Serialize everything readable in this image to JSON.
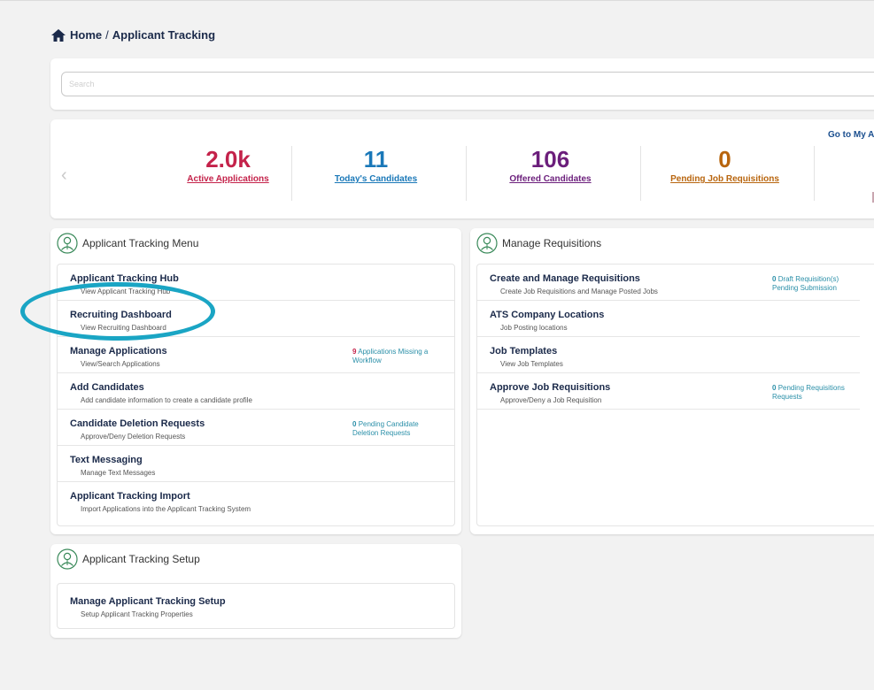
{
  "breadcrumb": {
    "home": "Home",
    "separator": "/",
    "current": "Applicant Tracking"
  },
  "search": {
    "placeholder": "Search",
    "value": ""
  },
  "stats": {
    "goto_link": "Go to My A",
    "items": [
      {
        "value": "2.0k",
        "label": "Active Applications",
        "color": "#c4224a"
      },
      {
        "value": "11",
        "label": "Today's Candidates",
        "color": "#1a78b8"
      },
      {
        "value": "106",
        "label": "Offered Candidates",
        "color": "#6b1e7b"
      },
      {
        "value": "0",
        "label": "Pending Job Requisitions",
        "color": "#b8650e"
      }
    ]
  },
  "menu_panel": {
    "title": "Applicant Tracking Menu",
    "items": [
      {
        "title": "Applicant Tracking Hub",
        "sub": "View Applicant Tracking Hub"
      },
      {
        "title": "Recruiting Dashboard",
        "sub": "View Recruiting Dashboard"
      },
      {
        "title": "Manage Applications",
        "sub": "View/Search Applications",
        "badge_num": "9",
        "badge_text": "Applications Missing a Workflow",
        "badge_num_color": "#c4224a"
      },
      {
        "title": "Add Candidates",
        "sub": "Add candidate information to create a candidate profile"
      },
      {
        "title": "Candidate Deletion Requests",
        "sub": "Approve/Deny Deletion Requests",
        "badge_num": "0",
        "badge_text": "Pending Candidate Deletion Requests"
      },
      {
        "title": "Text Messaging",
        "sub": "Manage Text Messages"
      },
      {
        "title": "Applicant Tracking Import",
        "sub": "Import Applications into the Applicant Tracking System"
      }
    ]
  },
  "requisitions_panel": {
    "title": "Manage Requisitions",
    "items": [
      {
        "title": "Create and Manage Requisitions",
        "sub": "Create Job Requisitions and Manage Posted Jobs",
        "badge_num": "0",
        "badge_text": "Draft Requisition(s) Pending Submission"
      },
      {
        "title": "ATS Company Locations",
        "sub": "Job Posting locations"
      },
      {
        "title": "Job Templates",
        "sub": "View Job Templates"
      },
      {
        "title": "Approve Job Requisitions",
        "sub": "Approve/Deny a Job Requisition",
        "badge_num": "0",
        "badge_text": "Pending Requisitions Requests"
      }
    ]
  },
  "setup_panel": {
    "title": "Applicant Tracking Setup",
    "items": [
      {
        "title": "Manage Applicant Tracking Setup",
        "sub": "Setup Applicant Tracking Properties"
      }
    ]
  },
  "icons": {
    "home": "home-icon",
    "prev": "chevron-left-icon",
    "panel": "recruiter-icon"
  },
  "colors": {
    "accent_teal": "#2a8fa8",
    "annotation": "#1aa5c4",
    "heading": "#1b2a4a"
  }
}
